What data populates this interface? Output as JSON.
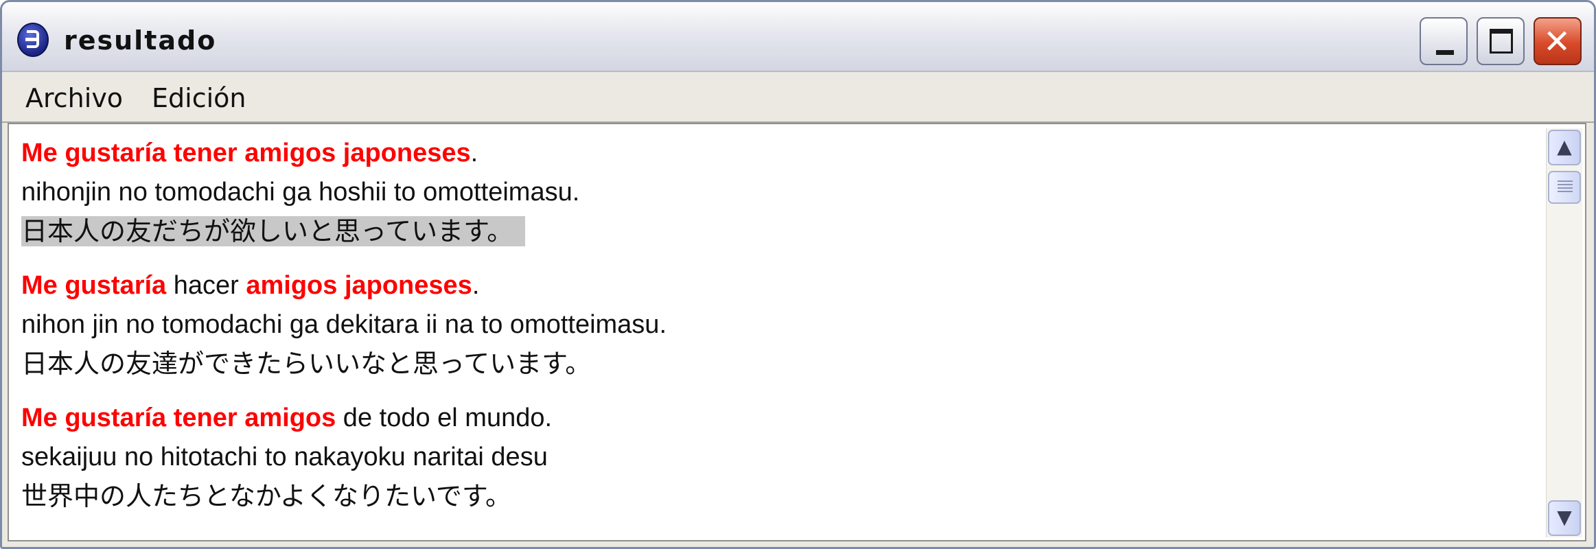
{
  "window": {
    "title": "resultado",
    "icon": "app-circle-icon"
  },
  "titlebar_buttons": {
    "minimize": "–",
    "maximize": "□",
    "close": "✕"
  },
  "menu": {
    "items": [
      "Archivo",
      "Edición"
    ]
  },
  "results": [
    {
      "spanish": [
        {
          "text": "Me gustaría tener amigos japoneses",
          "highlight": true
        },
        {
          "text": ".",
          "highlight": false
        }
      ],
      "romaji": "nihonjin no tomodachi ga hoshii to omotteimasu.",
      "japanese": "日本人の友だちが欲しいと思っています。"
    },
    {
      "spanish": [
        {
          "text": "Me gustaría",
          "highlight": true
        },
        {
          "text": " hacer ",
          "highlight": false
        },
        {
          "text": "amigos japoneses",
          "highlight": true
        },
        {
          "text": ".",
          "highlight": false
        }
      ],
      "romaji": "nihon jin no tomodachi ga dekitara ii na to omotteimasu.",
      "japanese": "日本人の友達ができたらいいなと思っています。"
    },
    {
      "spanish": [
        {
          "text": "Me gustaría tener amigos",
          "highlight": true
        },
        {
          "text": " de todo el mundo.",
          "highlight": false
        }
      ],
      "romaji": "sekaijuu no hitotachi to nakayoku naritai desu",
      "japanese": "世界中の人たちとなかよくなりたいです。"
    }
  ],
  "colors": {
    "highlight_text": "#ff0000",
    "selection": "#c8c8c8",
    "close_button": "#d84a2a"
  },
  "scrollbar": {
    "up": "▲",
    "down": "▼"
  }
}
